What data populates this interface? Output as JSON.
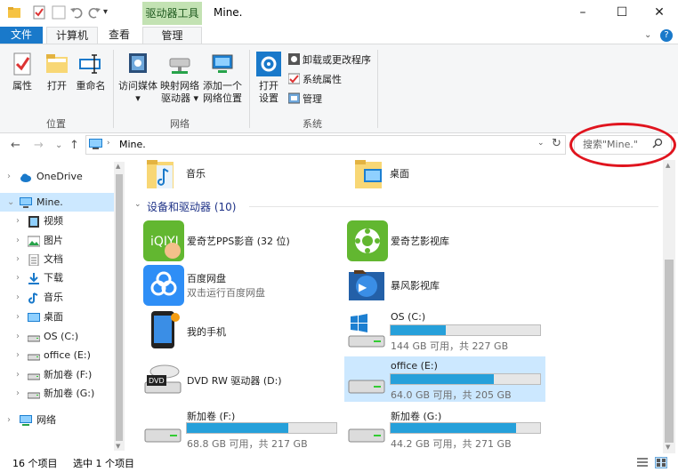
{
  "window": {
    "title": "Mine.",
    "context_tab": "驱动器工具",
    "minimize": "–",
    "maximize": "☐",
    "close": "✕"
  },
  "tabs": {
    "file": "文件",
    "computer": "计算机",
    "view": "查看",
    "manage": "管理",
    "help": "?"
  },
  "ribbon": {
    "location_group": {
      "label": "位置",
      "items": [
        "属性",
        "打开",
        "重命名"
      ]
    },
    "network_group": {
      "label": "网络",
      "items": [
        {
          "line1": "访问媒体",
          "line2": "▾"
        },
        {
          "line1": "映射网络",
          "line2": "驱动器 ▾"
        },
        {
          "line1": "添加一个",
          "line2": "网络位置"
        }
      ]
    },
    "system_group": {
      "label": "系统",
      "open_settings_1": "打开",
      "open_settings_2": "设置",
      "small_items": [
        "卸载或更改程序",
        "系统属性",
        "管理"
      ]
    }
  },
  "address": {
    "path": "Mine.",
    "search_placeholder": "搜索\"Mine.\""
  },
  "nav": {
    "items": [
      {
        "label": "OneDrive",
        "icon": "cloud-icon",
        "level": 0
      },
      {
        "label": "Mine.",
        "icon": "computer-icon",
        "level": 0,
        "selected": true
      },
      {
        "label": "视频",
        "icon": "video-folder-icon",
        "level": 1
      },
      {
        "label": "图片",
        "icon": "pictures-folder-icon",
        "level": 1
      },
      {
        "label": "文档",
        "icon": "documents-folder-icon",
        "level": 1
      },
      {
        "label": "下载",
        "icon": "download-folder-icon",
        "level": 1
      },
      {
        "label": "音乐",
        "icon": "music-folder-icon",
        "level": 1
      },
      {
        "label": "桌面",
        "icon": "desktop-folder-icon",
        "level": 1
      },
      {
        "label": "OS (C:)",
        "icon": "drive-icon",
        "level": 1
      },
      {
        "label": "office (E:)",
        "icon": "drive-icon",
        "level": 1
      },
      {
        "label": "新加卷 (F:)",
        "icon": "drive-icon",
        "level": 1
      },
      {
        "label": "新加卷 (G:)",
        "icon": "drive-icon",
        "level": 1
      },
      {
        "label": "网络",
        "icon": "network-icon",
        "level": 0
      }
    ]
  },
  "content": {
    "folders": [
      {
        "name": "音乐",
        "icon": "music-folder-icon"
      },
      {
        "name": "桌面",
        "icon": "desktop-folder-icon"
      }
    ],
    "devices_header": "设备和驱动器 (10)",
    "devices": [
      {
        "name": "爱奇艺PPS影音 (32 位)",
        "sub": "",
        "icon": "iqiyi-pps-icon"
      },
      {
        "name": "爱奇艺影视库",
        "sub": "",
        "icon": "iqiyi-library-icon"
      },
      {
        "name": "百度网盘",
        "sub": "双击运行百度网盘",
        "icon": "baidu-netdisk-icon"
      },
      {
        "name": "暴风影视库",
        "sub": "",
        "icon": "baofeng-library-icon"
      },
      {
        "name": "我的手机",
        "sub": "",
        "icon": "phone-icon"
      },
      {
        "name": "OS (C:)",
        "sub": "144 GB 可用，共 227 GB",
        "icon": "windows-drive-icon",
        "used": 0.37
      },
      {
        "name": "DVD RW 驱动器 (D:)",
        "sub": "",
        "icon": "dvd-drive-icon"
      },
      {
        "name": "office (E:)",
        "sub": "64.0 GB 可用，共 205 GB",
        "icon": "drive-icon",
        "used": 0.69,
        "selected": true
      },
      {
        "name": "新加卷 (F:)",
        "sub": "68.8 GB 可用，共 217 GB",
        "icon": "drive-icon",
        "used": 0.68
      },
      {
        "name": "新加卷 (G:)",
        "sub": "44.2 GB 可用，共 271 GB",
        "icon": "drive-icon",
        "used": 0.84
      }
    ]
  },
  "status": {
    "count": "16 个项目",
    "selected": "选中 1 个项目"
  },
  "colors": {
    "accent": "#1979ca",
    "bar_fill": "#26a0da",
    "selection": "#cce8ff",
    "context_tab": "#c3e2b3",
    "highlight_oval": "#e0141e"
  }
}
